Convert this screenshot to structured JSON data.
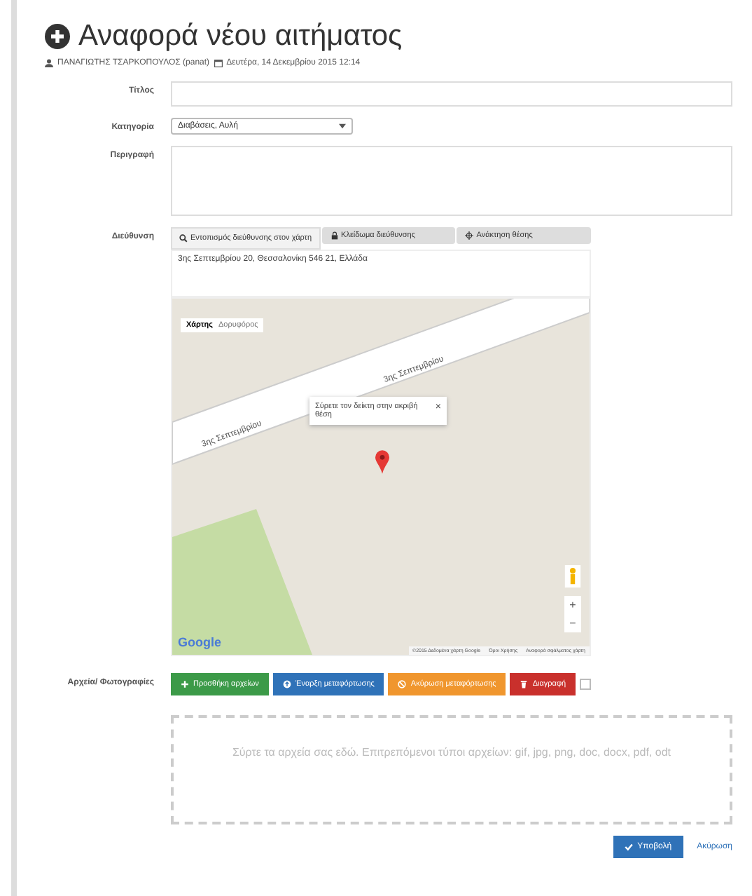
{
  "page_title": "Αναφορά νέου αιτήματος",
  "meta": {
    "user": "ΠΑΝΑΓΙΩΤΗΣ ΤΣΑΡΚΟΠΟΥΛΟΣ (panat)",
    "date": "Δευτέρα, 14 Δεκεμβρίου 2015 12:14"
  },
  "fields": {
    "title_label": "Τίτλος",
    "category_label": "Κατηγορία",
    "category_value": "Διαβάσεις, Αυλή",
    "description_label": "Περιγραφή",
    "address_label": "Διεύθυνση",
    "files_label": "Αρχεία/ Φωτογραφίες"
  },
  "map_buttons": [
    {
      "kind": "search",
      "label": "Εντοπισμός διεύθυνσης στον χάρτη",
      "selected": false
    },
    {
      "kind": "lock",
      "label": "Κλείδωμα διεύθυνσης",
      "selected": true
    },
    {
      "kind": "locate",
      "label": "Ανάκτηση θέσης",
      "selected": true
    }
  ],
  "address": "3ης Σεπτεμβρίου 20, Θεσσαλονίκη 546 21, Ελλάδα",
  "map": {
    "types": [
      {
        "label": "Χάρτης",
        "selected": true
      },
      {
        "label": "Δορυφόρος",
        "selected": false
      }
    ],
    "streets": [
      "3ης Σεπτεμβρίου",
      "3ης Σεπτεμβρίου"
    ],
    "info": "Σύρετε τον δείκτη στην ακριβή θέση",
    "close": "×",
    "logo": "Google",
    "footer": [
      "©2015 Δεδομένα χάρτη Google",
      "Όροι Χρήσης",
      "Αναφορά σφάλματος χάρτη"
    ],
    "zoom_in": "+",
    "zoom_out": "−"
  },
  "file_buttons": [
    {
      "kind": "add",
      "label": "Προσθήκη αρχείων",
      "color": "#3c9a48"
    },
    {
      "kind": "upload",
      "label": "Έναρξη μεταφόρτωσης",
      "color": "#2f72b8"
    },
    {
      "kind": "cancel",
      "label": "Ακύρωση μεταφόρτωσης",
      "color": "#f0962e"
    },
    {
      "kind": "delete",
      "label": "Διαγραφή",
      "color": "#c9302c"
    }
  ],
  "select_all": {
    "checked": false
  },
  "dropzone": "Σύρτε τα αρχεία σας εδώ. Επιτρεπόμενοι τύποι αρχείων: gif, jpg, png, doc, docx, pdf, odt",
  "actions": {
    "submit": "Υποβολή",
    "cancel": "Ακύρωση"
  }
}
